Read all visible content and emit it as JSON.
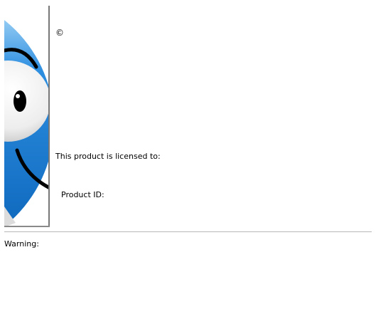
{
  "dialog": {
    "copyright_text": "©",
    "licensed_to_label": "This product is licensed to:",
    "product_id_label": "Product ID:",
    "warning_label": "Warning:"
  },
  "logo": {
    "icon": "smiling-face-logo",
    "colors": {
      "light_blue": "#d8ecfb",
      "mid_blue": "#2d8ee0",
      "dark_blue": "#0a63b8",
      "eye_white": "#f2f2f2",
      "eye_shadow": "#cfcfcf",
      "feature_black": "#000000",
      "border_gray": "#777777"
    }
  }
}
